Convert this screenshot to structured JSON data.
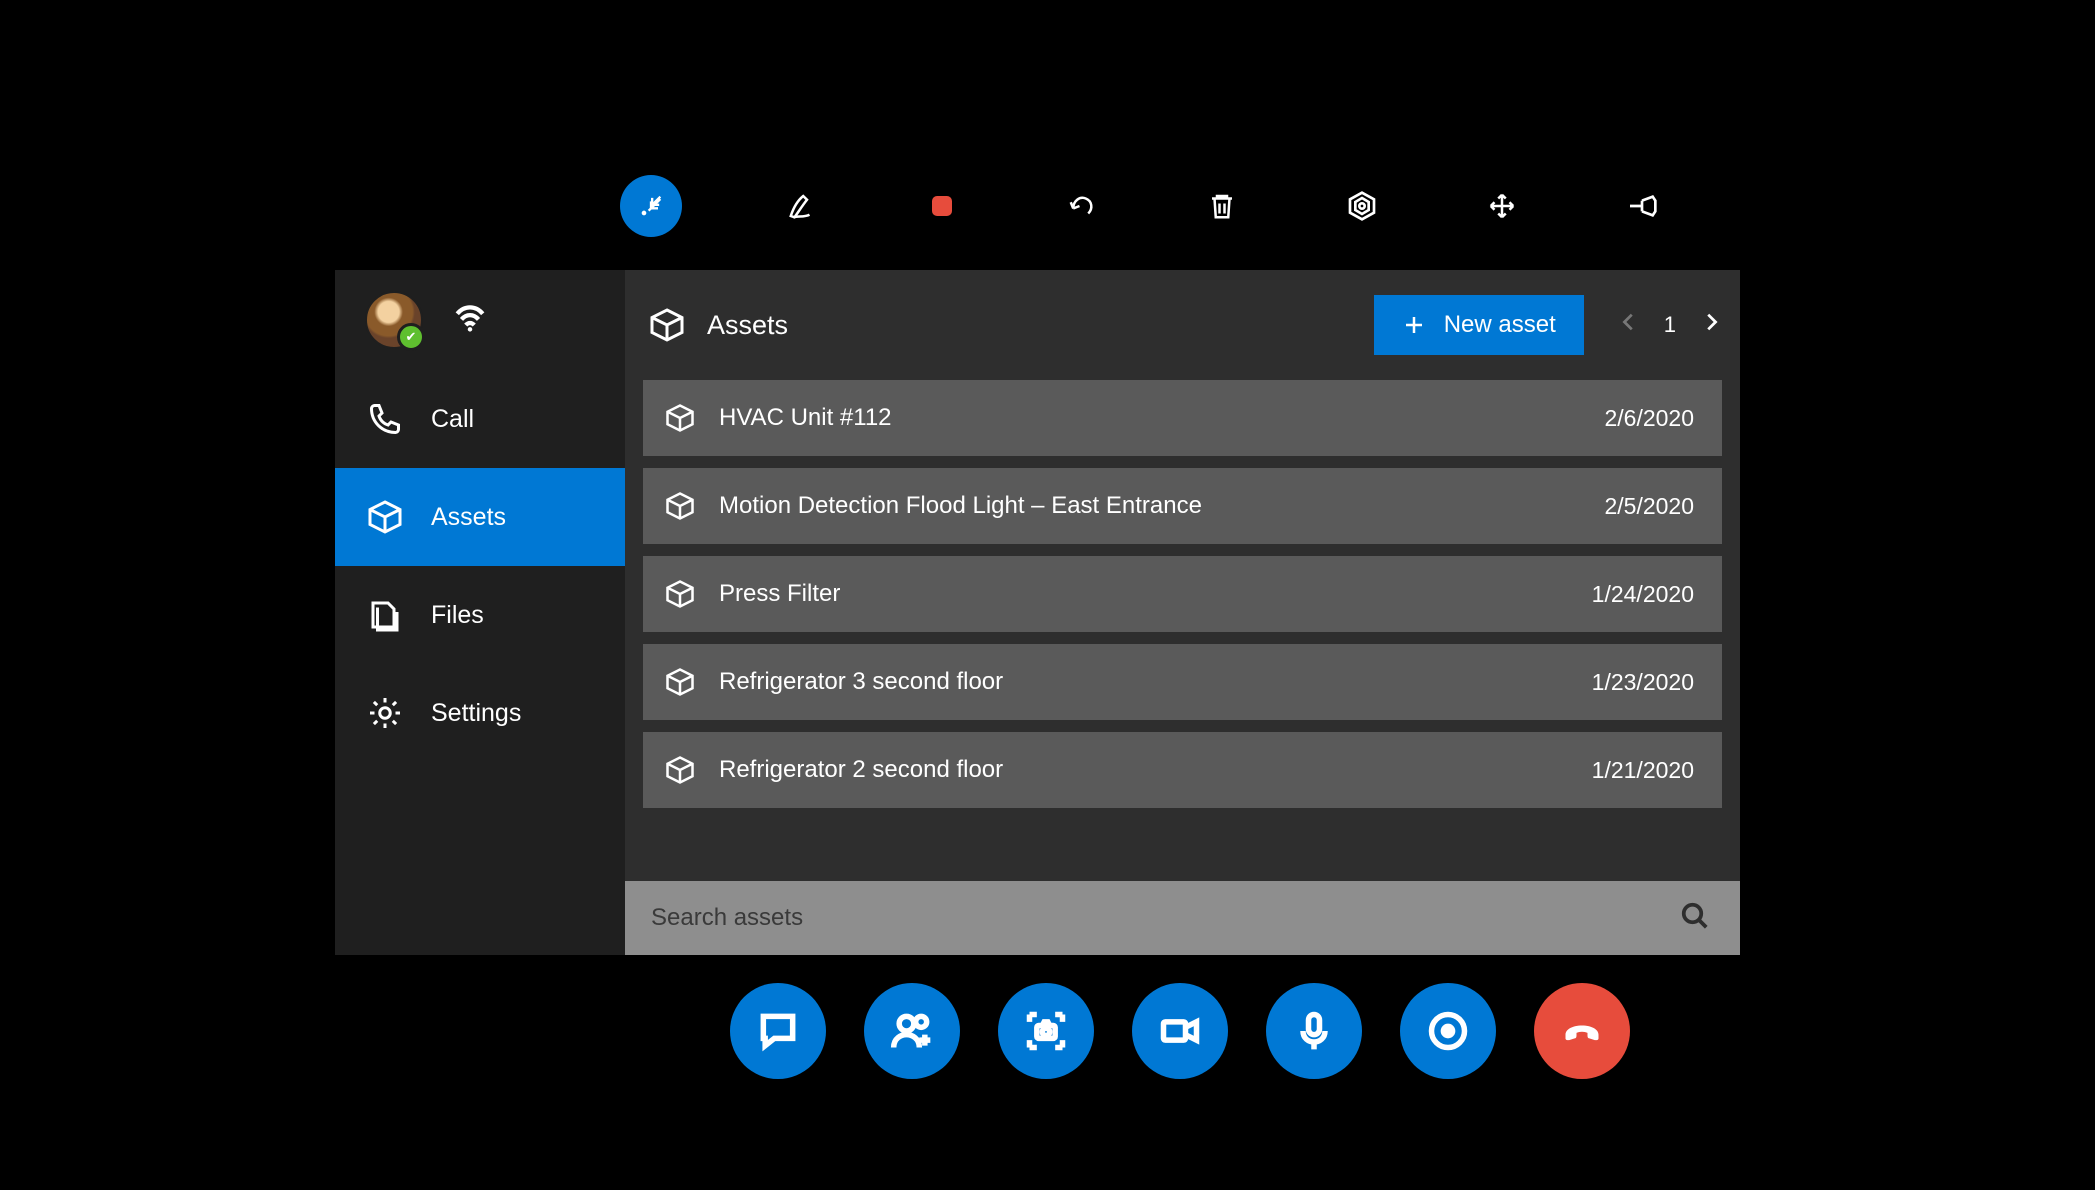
{
  "colors": {
    "accent": "#0078d4",
    "danger": "#e74c3c"
  },
  "top_toolbar": {
    "items": [
      {
        "name": "arrow-minimize-icon",
        "active": true
      },
      {
        "name": "ink-pen-icon",
        "active": false
      },
      {
        "name": "stop-recording-icon",
        "active": false
      },
      {
        "name": "undo-icon",
        "active": false
      },
      {
        "name": "delete-icon",
        "active": false
      },
      {
        "name": "target-icon",
        "active": false
      },
      {
        "name": "move-icon",
        "active": false
      },
      {
        "name": "pin-icon",
        "active": false
      }
    ]
  },
  "sidebar": {
    "items": [
      {
        "label": "Call",
        "icon": "phone-icon",
        "active": false
      },
      {
        "label": "Assets",
        "icon": "box-icon",
        "active": true
      },
      {
        "label": "Files",
        "icon": "files-icon",
        "active": false
      },
      {
        "label": "Settings",
        "icon": "gear-icon",
        "active": false
      }
    ]
  },
  "header": {
    "title": "Assets",
    "new_asset_label": "New asset",
    "page_number": "1"
  },
  "assets": [
    {
      "name": "HVAC Unit #112",
      "date": "2/6/2020"
    },
    {
      "name": "Motion Detection Flood Light – East Entrance",
      "date": "2/5/2020"
    },
    {
      "name": "Press Filter",
      "date": "1/24/2020"
    },
    {
      "name": "Refrigerator 3 second floor",
      "date": "1/23/2020"
    },
    {
      "name": "Refrigerator 2 second floor",
      "date": "1/21/2020"
    }
  ],
  "search": {
    "placeholder": "Search assets"
  }
}
